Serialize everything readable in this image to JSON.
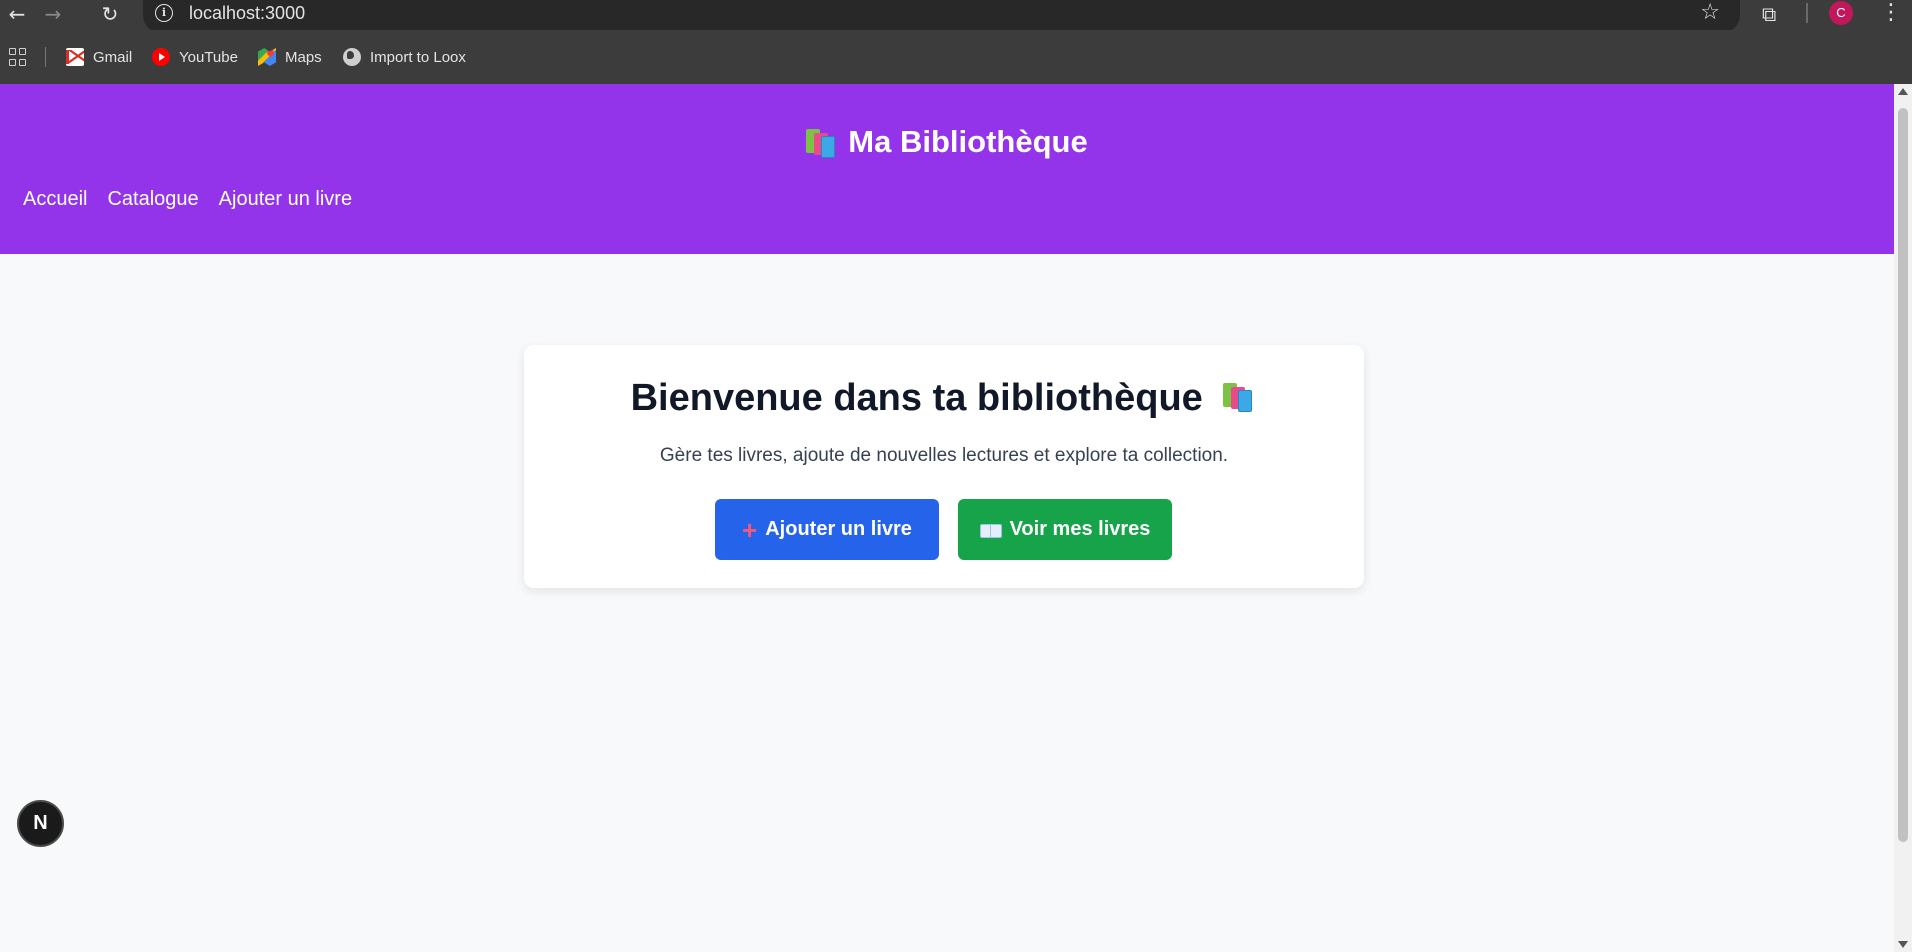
{
  "browser": {
    "back_glyph": "←",
    "forward_glyph": "→",
    "reload_glyph": "↻",
    "url": "localhost:3000",
    "star_glyph": "☆",
    "ext_glyph": "⧉",
    "profile_initial": "C",
    "menu_glyph": "⋮"
  },
  "bookmarks": [
    {
      "label": "Gmail",
      "icon": "gmail-icon"
    },
    {
      "label": "YouTube",
      "icon": "youtube-icon"
    },
    {
      "label": "Maps",
      "icon": "maps-icon"
    },
    {
      "label": "Import to Loox",
      "icon": "globe-icon"
    }
  ],
  "header": {
    "title": "Ma Bibliothèque",
    "nav": [
      "Accueil",
      "Catalogue",
      "Ajouter un livre"
    ],
    "background": "#9333ea"
  },
  "hero": {
    "title": "Bienvenue dans ta bibliothèque",
    "subtitle": "Gère tes livres, ajoute de nouvelles lectures et explore ta collection.",
    "add_button": "Ajouter un livre",
    "view_button": "Voir mes livres",
    "add_color": "#2563eb",
    "view_color": "#16a34a"
  },
  "dev_badge": "N"
}
